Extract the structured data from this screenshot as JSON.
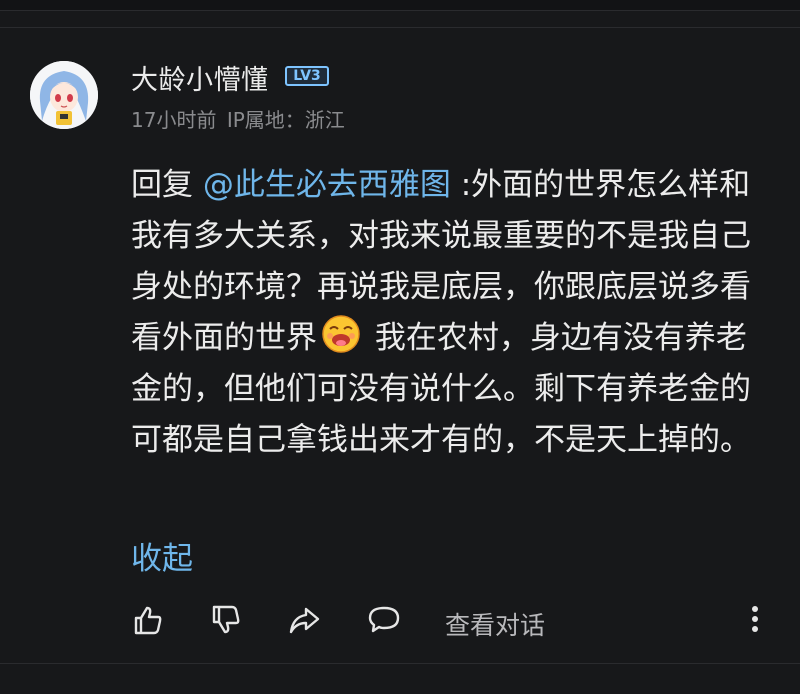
{
  "comment": {
    "username": "大龄小懵懂",
    "level_badge": "LV3",
    "time": "17小时前",
    "ip_location": "IP属地：浙江",
    "reply_prefix": "回复 ",
    "mention": "@此生必去西雅图",
    "text_before_emoji": " :外面的世界怎么样和我有多大关系，对我来说最重要的不是我自己身处的环境？再说我是底层，你跟底层说多看看外面的世界",
    "emoji_name": "laughing-tongue-emoji",
    "text_after_emoji": " 我在农村，身边有没有养老金的，但他们可没有说什么。剩下有养老金的可都是自己拿钱出来才有的，不是天上掉的。",
    "collapse_label": "收起"
  },
  "actions": {
    "like_icon": "thumbs-up-icon",
    "dislike_icon": "thumbs-down-icon",
    "share_icon": "share-icon",
    "reply_icon": "comment-bubble-icon",
    "view_conversation_label": "查看对话",
    "more_icon": "more-vertical-icon"
  },
  "colors": {
    "background": "#17181a",
    "link": "#6fb6ea",
    "meta_text": "#8a8b8e",
    "level_badge": "#7ec4ff"
  }
}
